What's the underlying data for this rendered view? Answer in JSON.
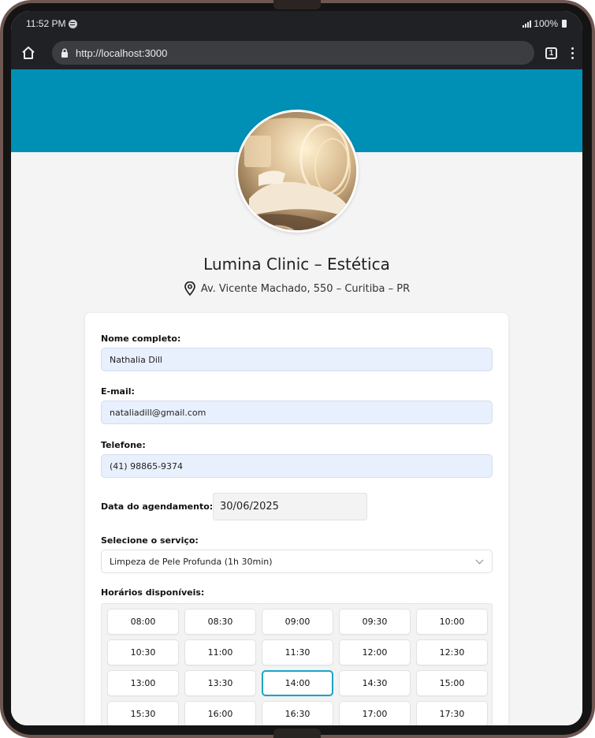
{
  "status": {
    "time": "11:52 PM",
    "battery": "100%"
  },
  "browser": {
    "url": "http://localhost:3000",
    "tab_count": "1"
  },
  "clinic": {
    "name": "Lumina Clinic – Estética",
    "address": "Av. Vicente Machado, 550 – Curitiba – PR"
  },
  "form": {
    "name_label": "Nome completo:",
    "name_value": "Nathalia Dill",
    "email_label": "E-mail:",
    "email_value": "nataliadill@gmail.com",
    "phone_label": "Telefone:",
    "phone_value": "(41) 98865-9374",
    "date_label": "Data do agendamento:",
    "date_value": "30/06/2025",
    "service_label": "Selecione o serviço:",
    "service_value": "Limpeza de Pele Profunda (1h 30min)",
    "slots_label": "Horários disponíveis:"
  },
  "slots": [
    "08:00",
    "08:30",
    "09:00",
    "09:30",
    "10:00",
    "10:30",
    "11:00",
    "11:30",
    "12:00",
    "12:30",
    "13:00",
    "13:30",
    "14:00",
    "14:30",
    "15:00",
    "15:30",
    "16:00",
    "16:30",
    "17:00",
    "17:30"
  ],
  "selected_slot": "14:00",
  "colors": {
    "banner": "#0090b6",
    "accent": "#1aa3c8",
    "field_bg": "#e8f0fd"
  }
}
